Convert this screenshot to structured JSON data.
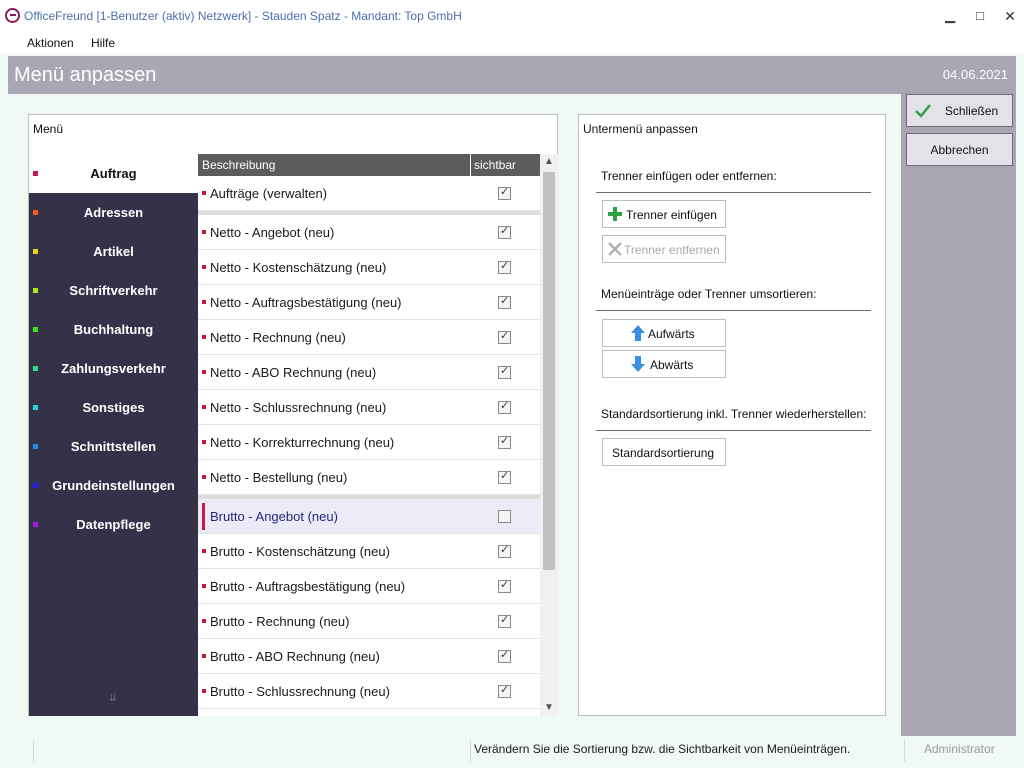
{
  "window": {
    "title": "OfficeFreund [1-Benutzer (aktiv) Netzwerk]  -  Stauden Spatz  -  Mandant: Top GmbH",
    "minimize_glyph": "▁",
    "maximize_glyph": "□",
    "close_glyph": "✕"
  },
  "menubar": {
    "aktionen": "Aktionen",
    "hilfe": "Hilfe"
  },
  "header": {
    "title": "Menü anpassen",
    "date": "04.06.2021"
  },
  "actions": {
    "close": "Schließen",
    "cancel": "Abbrechen"
  },
  "menu_panel": {
    "title": "Menü",
    "sidebar": [
      {
        "label": "Auftrag",
        "color": "#c8184a",
        "active": true
      },
      {
        "label": "Adressen",
        "color": "#e8601c",
        "active": false
      },
      {
        "label": "Artikel",
        "color": "#e8d41c",
        "active": false
      },
      {
        "label": "Schriftverkehr",
        "color": "#a8e81c",
        "active": false
      },
      {
        "label": "Buchhaltung",
        "color": "#32e81c",
        "active": false
      },
      {
        "label": "Zahlungsverkehr",
        "color": "#1ce88a",
        "active": false
      },
      {
        "label": "Sonstiges",
        "color": "#1cd8e8",
        "active": false
      },
      {
        "label": "Schnittstellen",
        "color": "#1c8ae8",
        "active": false
      },
      {
        "label": "Grundeinstellungen",
        "color": "#2c1ce8",
        "active": false
      },
      {
        "label": "Datenpflege",
        "color": "#a01ce8",
        "active": false
      }
    ],
    "more_glyph": "⇊",
    "table": {
      "col_description": "Beschreibung",
      "col_visible": "sichtbar",
      "rows": [
        {
          "label": "Aufträge (verwalten)",
          "visible": true
        },
        {
          "separator": true
        },
        {
          "label": "Netto - Angebot (neu)",
          "visible": true
        },
        {
          "label": "Netto - Kostenschätzung (neu)",
          "visible": true
        },
        {
          "label": "Netto - Auftragsbestätigung (neu)",
          "visible": true
        },
        {
          "label": "Netto - Rechnung (neu)",
          "visible": true
        },
        {
          "label": "Netto - ABO Rechnung (neu)",
          "visible": true
        },
        {
          "label": "Netto - Schlussrechnung (neu)",
          "visible": true
        },
        {
          "label": "Netto - Korrekturrechnung (neu)",
          "visible": true
        },
        {
          "label": "Netto - Bestellung (neu)",
          "visible": true
        },
        {
          "separator": true
        },
        {
          "label": "Brutto - Angebot (neu)",
          "visible": false,
          "selected": true
        },
        {
          "label": "Brutto - Kostenschätzung (neu)",
          "visible": true
        },
        {
          "label": "Brutto - Auftragsbestätigung (neu)",
          "visible": true
        },
        {
          "label": "Brutto - Rechnung (neu)",
          "visible": true
        },
        {
          "label": "Brutto - ABO Rechnung (neu)",
          "visible": true
        },
        {
          "label": "Brutto - Schlussrechnung (neu)",
          "visible": true
        },
        {
          "label": "",
          "visible": true
        }
      ]
    }
  },
  "submenu_panel": {
    "title": "Untermenü anpassen",
    "separator_section": "Trenner einfügen oder entfernen:",
    "insert_separator": "Trenner einfügen",
    "remove_separator": "Trenner entfernen",
    "sort_section": "Menüeinträge oder Trenner umsortieren:",
    "up": "Aufwärts",
    "down": "Abwärts",
    "reset_section": "Standardsortierung inkl. Trenner wiederherstellen:",
    "reset": "Standardsortierung"
  },
  "status": {
    "text": "Verändern Sie die Sortierung bzw. die Sichtbarkeit von Menüeinträgen.",
    "user": "Administrator"
  }
}
